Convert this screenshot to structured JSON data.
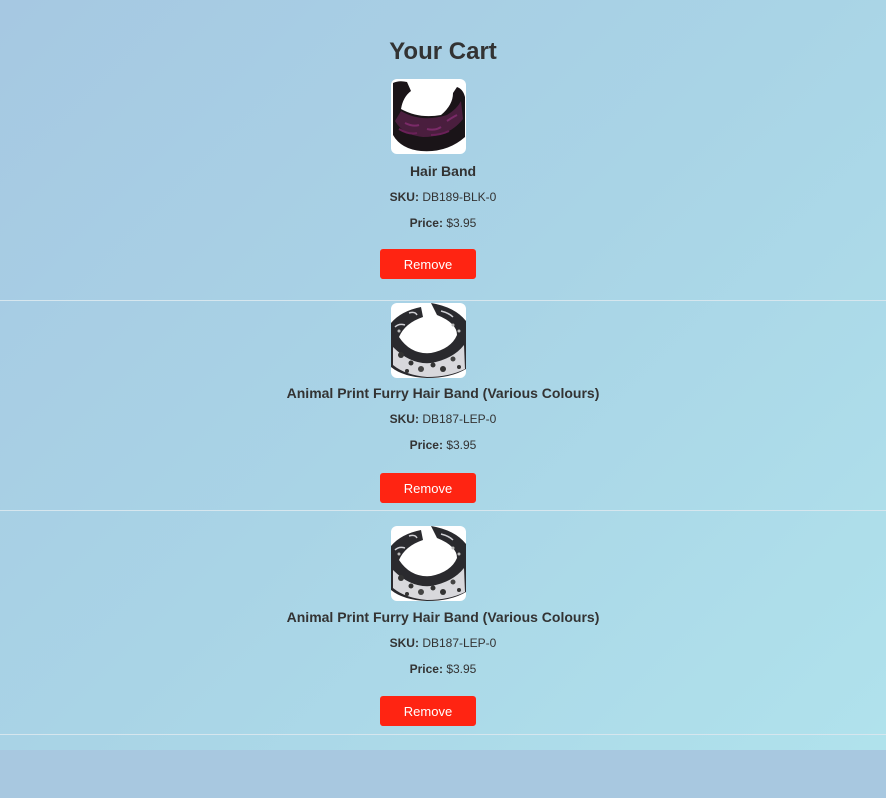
{
  "page": {
    "title": "Your Cart"
  },
  "cart": {
    "sku_label": "SKU:",
    "price_label": "Price:",
    "items": [
      {
        "name": "Hair Band",
        "sku": "DB189-BLK-0",
        "price": "$3.95",
        "remove_label": "Remove",
        "thumbnail": "black-hair-band-image"
      },
      {
        "name": "Animal Print Furry Hair Band (Various Colours)",
        "sku": "DB187-LEP-0",
        "price": "$3.95",
        "remove_label": "Remove",
        "thumbnail": "leopard-print-hair-band-image"
      },
      {
        "name": "Animal Print Furry Hair Band (Various Colours)",
        "sku": "DB187-LEP-0",
        "price": "$3.95",
        "remove_label": "Remove",
        "thumbnail": "leopard-print-hair-band-image"
      }
    ]
  },
  "colors": {
    "remove_button": "#ff2412",
    "text": "#333333"
  }
}
